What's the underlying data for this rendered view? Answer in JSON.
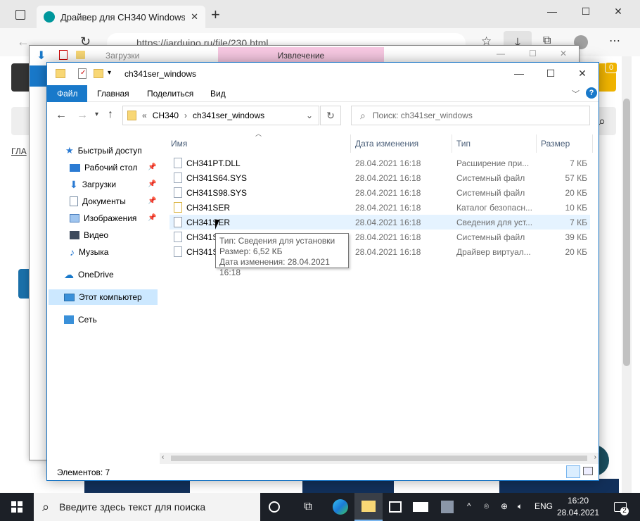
{
  "browser": {
    "tab_title": "Драйвер для CH340 Windows (А",
    "url": "https://iarduino.ru/file/230.html",
    "badge_count": "0",
    "new_tab_glyph": "+",
    "breadcrumb_fragment": "ГЛА"
  },
  "background_window": {
    "title": "Загрузки",
    "extract_tab": "Извлечение"
  },
  "window": {
    "title": "ch341ser_windows",
    "ribbon_tabs": [
      "Файл",
      "Главная",
      "Поделиться",
      "Вид"
    ],
    "breadcrumb": [
      "CH340",
      "ch341ser_windows"
    ],
    "breadcrumb_prefix": "«",
    "search_placeholder": "Поиск: ch341ser_windows",
    "status": "Элементов: 7"
  },
  "nav": {
    "quick_access": "Быстрый доступ",
    "desktop": "Рабочий стол",
    "downloads": "Загрузки",
    "documents": "Документы",
    "images": "Изображения",
    "video": "Видео",
    "music": "Музыка",
    "onedrive": "OneDrive",
    "this_pc": "Этот компьютер",
    "network": "Сеть"
  },
  "columns": {
    "name": "Имя",
    "date": "Дата изменения",
    "type": "Тип",
    "size": "Размер"
  },
  "files": [
    {
      "name": "CH341PT.DLL",
      "date": "28.04.2021 16:18",
      "type": "Расширение при...",
      "size": "7 КБ",
      "icon": "dll-file-icon"
    },
    {
      "name": "CH341S64.SYS",
      "date": "28.04.2021 16:18",
      "type": "Системный файл",
      "size": "57 КБ",
      "icon": "sys-file-icon"
    },
    {
      "name": "CH341S98.SYS",
      "date": "28.04.2021 16:18",
      "type": "Системный файл",
      "size": "20 КБ",
      "icon": "sys-file-icon"
    },
    {
      "name": "CH341SER",
      "date": "28.04.2021 16:18",
      "type": "Каталог безопасн...",
      "size": "10 КБ",
      "icon": "catalog-file-icon"
    },
    {
      "name": "CH341SER",
      "date": "28.04.2021 16:18",
      "type": "Сведения для уст...",
      "size": "7 КБ",
      "icon": "inf-file-icon"
    },
    {
      "name": "CH341SER.SYS",
      "date": "28.04.2021 16:18",
      "type": "Системный файл",
      "size": "39 КБ",
      "icon": "sys-file-icon"
    },
    {
      "name": "CH341SER.VXD",
      "date": "28.04.2021 16:18",
      "type": "Драйвер виртуал...",
      "size": "20 КБ",
      "icon": "vxd-file-icon"
    }
  ],
  "tooltip": {
    "line1": "Тип: Сведения для установки",
    "line2": "Размер: 6,52 КБ",
    "line3": "Дата изменения: 28.04.2021 16:18"
  },
  "taskbar": {
    "search_placeholder": "Введите здесь текст для поиска",
    "language": "ENG",
    "time": "16:20",
    "date": "28.04.2021",
    "notification_count": "2"
  }
}
